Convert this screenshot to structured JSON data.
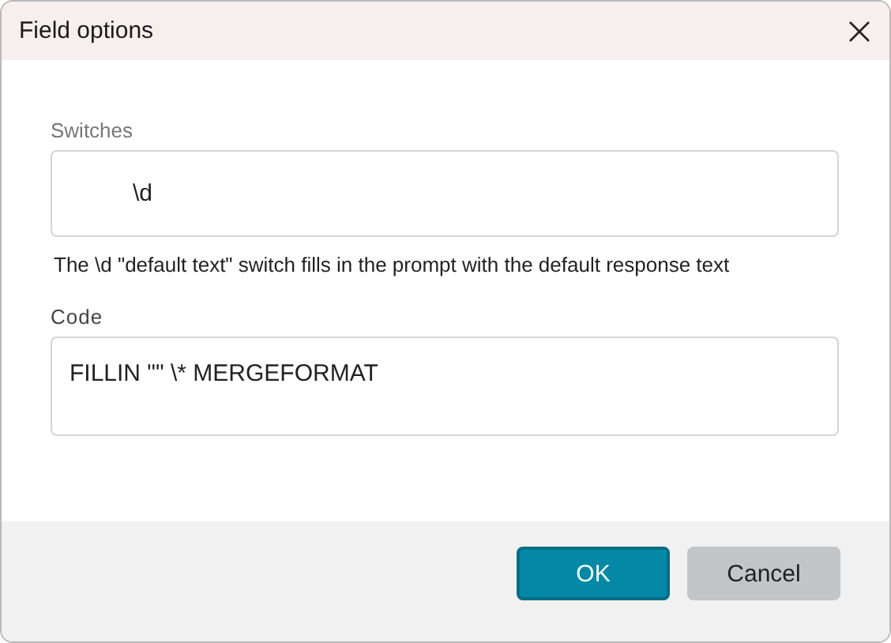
{
  "window": {
    "title": "Field options"
  },
  "switches": {
    "label": "Switches",
    "value": "\\d"
  },
  "description": "The \\d \"default text\" switch fills in the prompt with the default response text",
  "code": {
    "label": "Code",
    "value": "FILLIN \"\" \\* MERGEFORMAT"
  },
  "buttons": [
    {
      "label": "OK",
      "kind": "primary"
    },
    {
      "label": "Cancel",
      "kind": "secondary"
    }
  ]
}
